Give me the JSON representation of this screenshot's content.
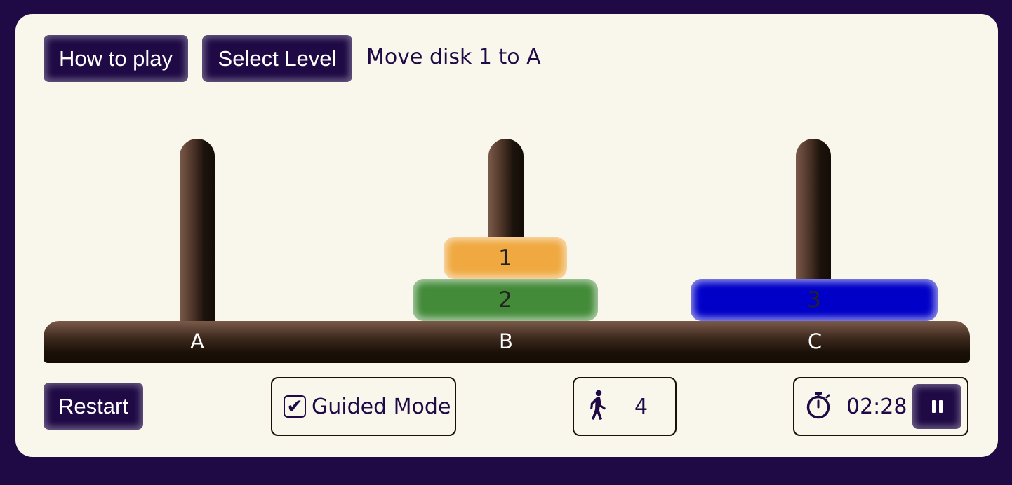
{
  "toolbar": {
    "how_to_play_label": "How to play",
    "select_level_label": "Select Level",
    "instruction": "Move disk 1 to A"
  },
  "pegs": [
    {
      "label": "A",
      "disks": []
    },
    {
      "label": "B",
      "disks": [
        "1",
        "2"
      ]
    },
    {
      "label": "C",
      "disks": [
        "3"
      ]
    }
  ],
  "disks": [
    {
      "number": "1",
      "color": "#efa940",
      "peg": "B"
    },
    {
      "number": "2",
      "color": "#438b38",
      "peg": "B"
    },
    {
      "number": "3",
      "color": "#0000c8",
      "peg": "C"
    }
  ],
  "controls": {
    "restart_label": "Restart",
    "guided_mode": {
      "label": "Guided Mode",
      "checked": true,
      "check_glyph": "✔"
    },
    "moves": {
      "icon": "walking-person-icon",
      "count": "4"
    },
    "timer": {
      "icon": "stopwatch-icon",
      "value": "02:28",
      "pause_icon": "pause-icon"
    }
  },
  "colors": {
    "background": "#1f0a45",
    "card": "#f9f7ec",
    "accent": "#1f0a45"
  }
}
